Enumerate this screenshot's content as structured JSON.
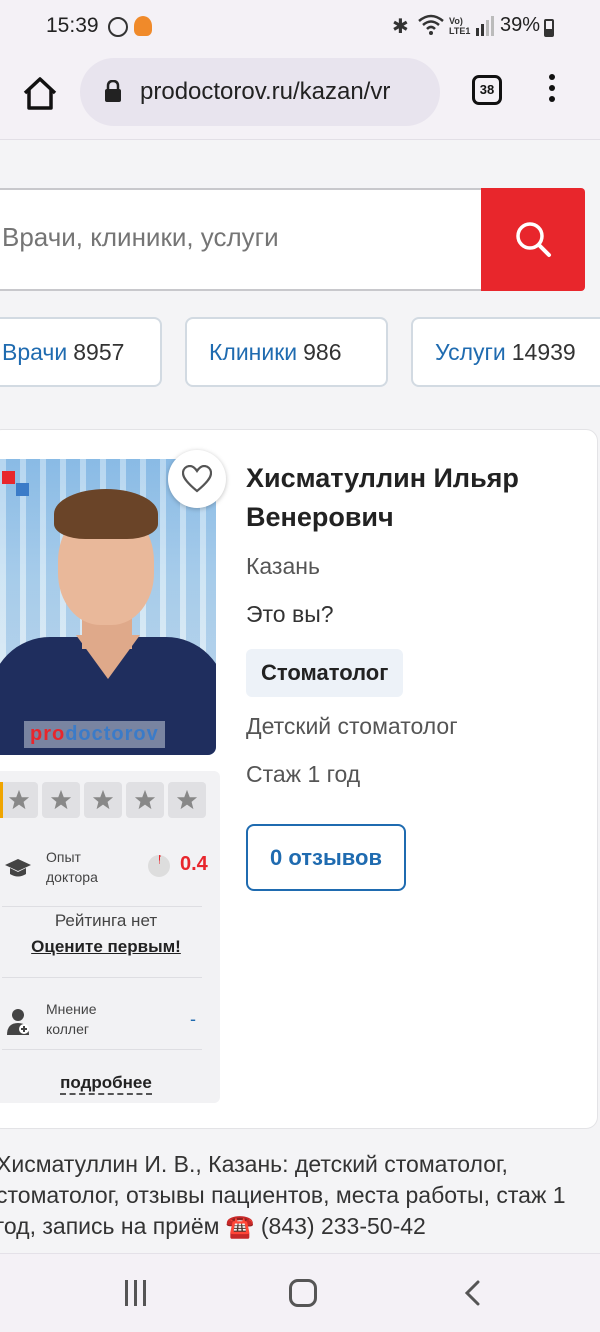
{
  "status_bar": {
    "time": "15:39",
    "battery": "39%",
    "volte_label": "Vo)\nLTE1",
    "icons": [
      "whatsapp-icon",
      "app-notification-icon",
      "bluetooth-icon",
      "wifi-icon",
      "signal-icon",
      "battery-icon"
    ]
  },
  "browser": {
    "url": "prodoctorov.ru/kazan/vr",
    "tab_count": "38",
    "icons": [
      "home-icon",
      "lock-icon",
      "tabs-icon",
      "menu-icon"
    ]
  },
  "search": {
    "placeholder": "Врачи, клиники, услуги",
    "button_color": "#e8262c"
  },
  "categories": [
    {
      "label": "Врачи",
      "count": "8957"
    },
    {
      "label": "Клиники",
      "count": "986"
    },
    {
      "label": "Услуги",
      "count": "14939"
    }
  ],
  "doctor": {
    "name": "Хисматуллин Ильяр Венерович",
    "city": "Казань",
    "claim_profile": "Это вы?",
    "specialty": "Стоматолог",
    "subspecialty": "Детский стоматолог",
    "experience": "Стаж 1 год",
    "reviews_button": "0 отзывов",
    "photo_watermark_pro": "pro",
    "photo_watermark_doctorov": "doctorov",
    "photo_logo": "Pd"
  },
  "rating_panel": {
    "stars_filled": 0,
    "stars_total": 5,
    "experience_label": "Опыт доктора",
    "experience_value": "0.4",
    "no_rating": "Рейтинга нет",
    "rate_first": "Оцените первым!",
    "peer_label": "Мнение коллег",
    "peer_value": "-",
    "more_link": "подробнее"
  },
  "description": "Хисматуллин И. В., Казань: детский стоматолог, стоматолог, отзывы пациентов, места работы, стаж 1 год, запись на приём ☎️ (843) 233-50-42",
  "colors": {
    "accent_red": "#e8262c",
    "link_blue": "#1f6bb0",
    "star_accent": "#f0a500"
  },
  "nav_bar": {
    "icons": [
      "recent-apps-icon",
      "home-button-icon",
      "back-icon"
    ]
  }
}
